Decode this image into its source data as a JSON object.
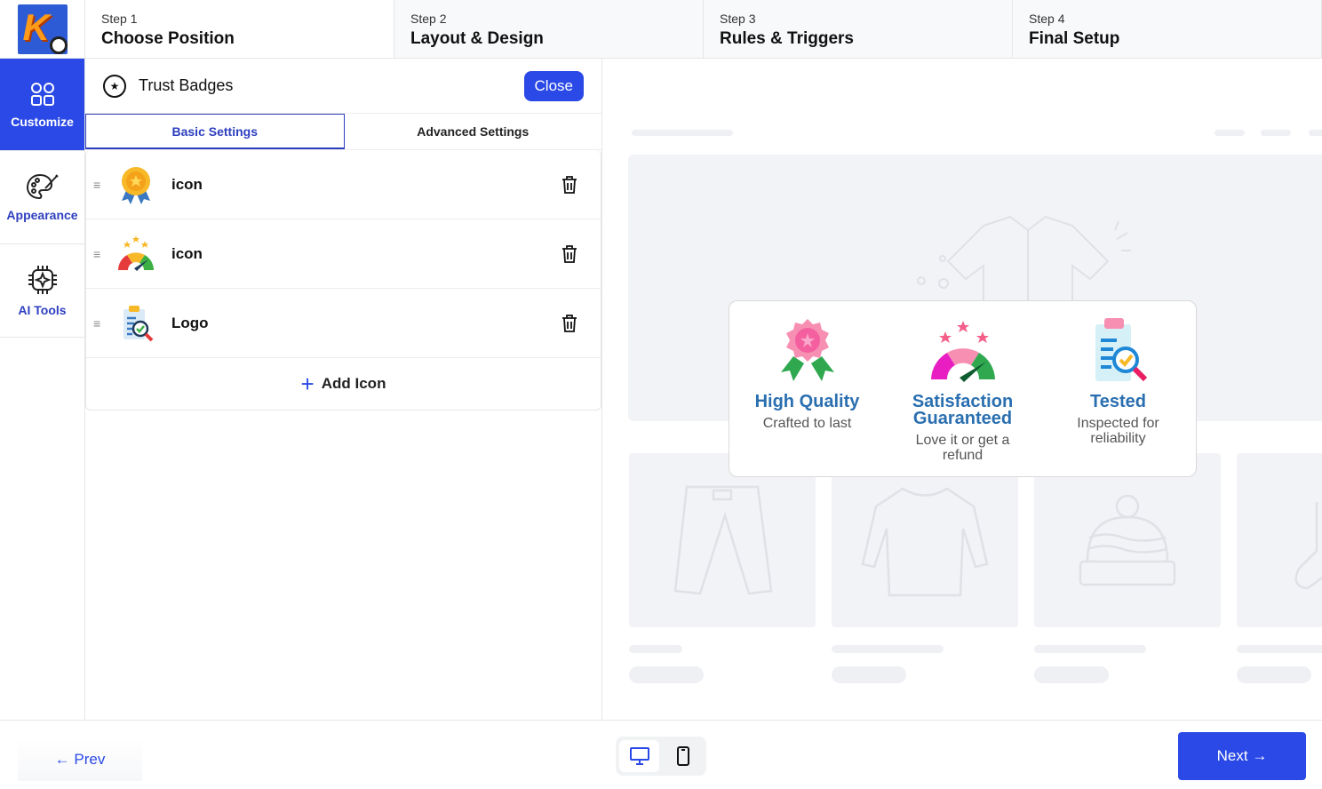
{
  "header": {
    "logo_letter": "K",
    "steps": [
      {
        "num": "Step 1",
        "title": "Choose Position"
      },
      {
        "num": "Step 2",
        "title": "Layout & Design"
      },
      {
        "num": "Step 3",
        "title": "Rules & Triggers"
      },
      {
        "num": "Step 4",
        "title": "Final Setup"
      }
    ]
  },
  "sidebar": {
    "items": [
      {
        "label": "Customize",
        "icon": "grid-icon"
      },
      {
        "label": "Appearance",
        "icon": "palette-icon"
      },
      {
        "label": "AI Tools",
        "icon": "chip-icon"
      }
    ]
  },
  "panel": {
    "title": "Trust Badges",
    "close_label": "Close",
    "tabs": [
      "Basic Settings",
      "Advanced Settings"
    ],
    "rows": [
      {
        "label": "icon",
        "icon": "medal-icon"
      },
      {
        "label": "icon",
        "icon": "gauge-icon"
      },
      {
        "label": "Logo",
        "icon": "clipboard-search-icon"
      }
    ],
    "add_label": "Add Icon"
  },
  "preview": {
    "badges": [
      {
        "title": "High Quality",
        "subtitle": "Crafted to last"
      },
      {
        "title": "Satisfaction Guaranteed",
        "subtitle": "Love it or get a refund"
      },
      {
        "title": "Tested",
        "subtitle": "Inspected for reliability"
      }
    ]
  },
  "footer": {
    "prev_label": "← Prev",
    "next_label": "Next →"
  },
  "colors": {
    "accent": "#2a49e6",
    "badge_title": "#2a6fb0"
  }
}
